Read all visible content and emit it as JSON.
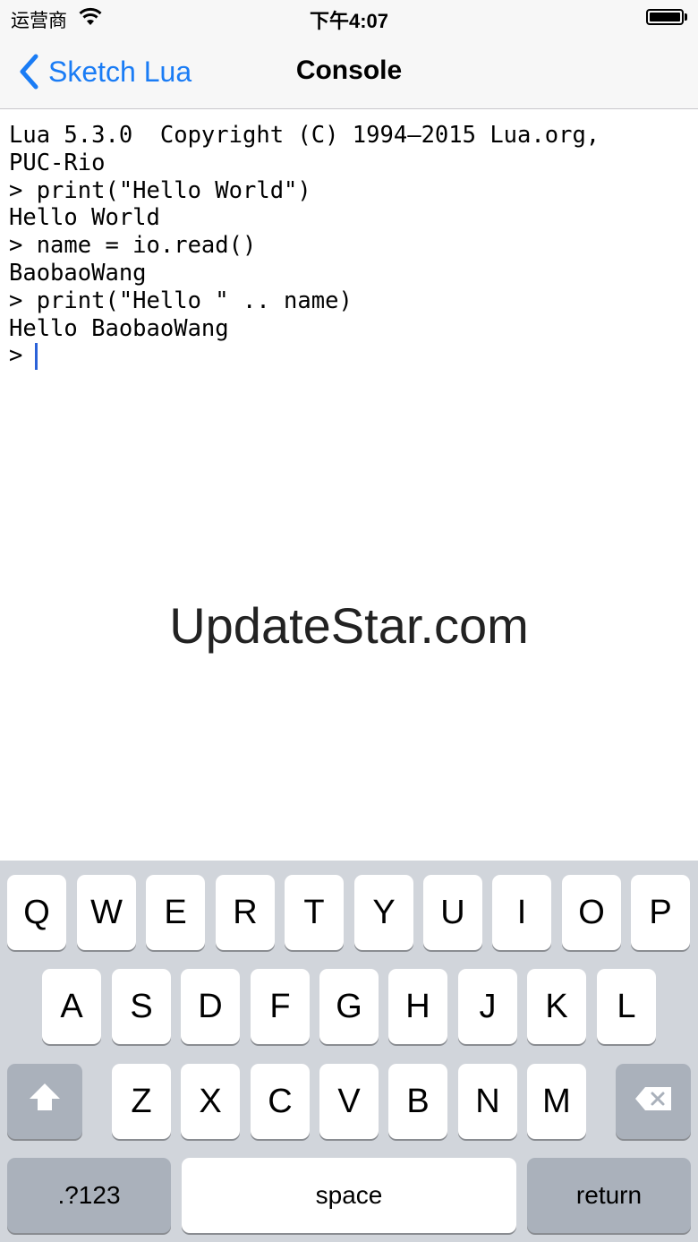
{
  "status_bar": {
    "carrier": "运营商",
    "time": "下午4:07",
    "wifi_icon": "wifi-icon",
    "battery_icon": "battery-icon",
    "battery_level": 1.0
  },
  "nav": {
    "back_label": "Sketch Lua",
    "back_icon": "chevron-left-icon",
    "title": "Console"
  },
  "console": {
    "lines": [
      "Lua 5.3.0  Copyright (C) 1994–2015 Lua.org,",
      "PUC-Rio",
      "> print(\"Hello World\")",
      "Hello World",
      "> name = io.read()",
      "BaobaoWang",
      "> print(\"Hello \" .. name)",
      "Hello BaobaoWang"
    ],
    "prompt": ">"
  },
  "watermark": "UpdateStar.com",
  "keyboard": {
    "row1": [
      "Q",
      "W",
      "E",
      "R",
      "T",
      "Y",
      "U",
      "I",
      "O",
      "P"
    ],
    "row2": [
      "A",
      "S",
      "D",
      "F",
      "G",
      "H",
      "J",
      "K",
      "L"
    ],
    "row3": [
      "Z",
      "X",
      "C",
      "V",
      "B",
      "N",
      "M"
    ],
    "shift_icon": "shift-icon",
    "delete_icon": "backspace-icon",
    "numbers_label": ".?123",
    "space_label": "space",
    "return_label": "return"
  },
  "colors": {
    "accent": "#1a7cf5",
    "cursor": "#2b62d8",
    "keyboard_bg": "#d1d5db",
    "special_key": "#aab1bb"
  }
}
